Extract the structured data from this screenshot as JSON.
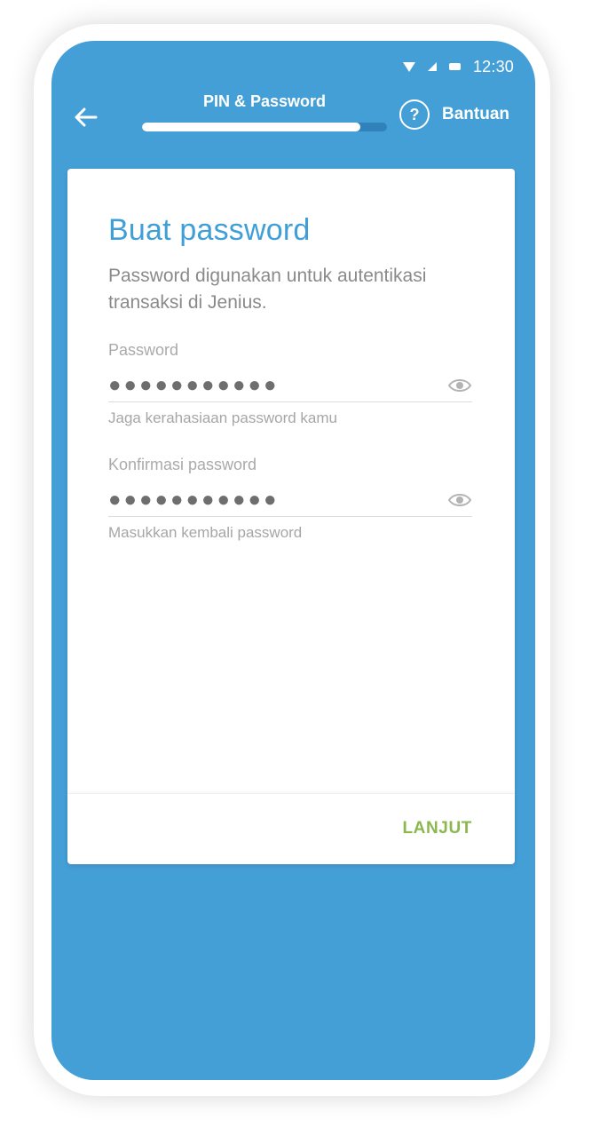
{
  "status_bar": {
    "time": "12:30"
  },
  "header": {
    "title": "PIN & Password",
    "progress": 0.89,
    "help_symbol": "?",
    "help_label": "Bantuan"
  },
  "card": {
    "title": "Buat password",
    "description": "Password digunakan untuk autentikasi transaksi di Jenius.",
    "fields": [
      {
        "label": "Password",
        "value": "●●●●●●●●●●●",
        "helper": "Jaga kerahasiaan password kamu",
        "icon": "eye-icon"
      },
      {
        "label": "Konfirmasi password",
        "value": "●●●●●●●●●●●",
        "helper": "Masukkan kembali password",
        "icon": "eye-icon"
      }
    ],
    "next_label": "LANJUT"
  },
  "colors": {
    "primary": "#459fd7",
    "title": "#3f9fd6",
    "action": "#8bb84d"
  }
}
